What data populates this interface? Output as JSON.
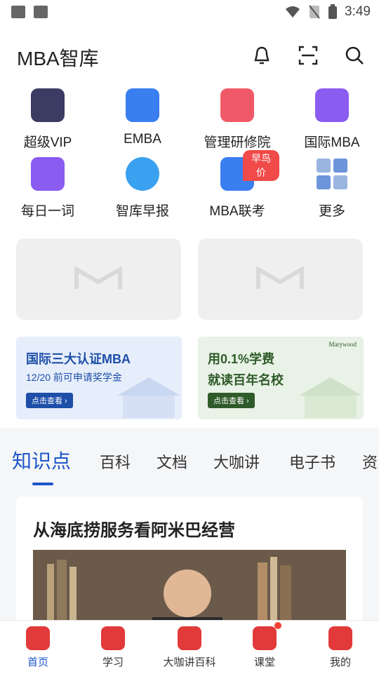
{
  "status": {
    "time": "3:49"
  },
  "header": {
    "title": "MBA智库"
  },
  "quick": {
    "items": [
      {
        "label": "超级VIP",
        "icon": "vip-icon",
        "color": "#3b3b63"
      },
      {
        "label": "EMBA",
        "icon": "document-icon",
        "color": "#3a7ef0"
      },
      {
        "label": "管理研修院",
        "icon": "building-icon",
        "color": "#f05a68"
      },
      {
        "label": "国际MBA",
        "icon": "shield-icon",
        "color": "#8a5cf0"
      },
      {
        "label": "每日一词",
        "icon": "calendar-icon",
        "color": "#8a5cf0"
      },
      {
        "label": "智库早报",
        "icon": "clock-icon",
        "color": "#3aa0f0"
      },
      {
        "label": "MBA联考",
        "icon": "flag-chart-icon",
        "color": "#3a7ef0",
        "badge": "早鸟价"
      },
      {
        "label": "更多",
        "icon": "grid-icon",
        "color": "#7aa6e8"
      }
    ]
  },
  "banners": [
    {
      "line1": "国际三大认证MBA",
      "line2": "12/20 前可申请奖学金",
      "btn": "点击查看 ›",
      "bg": "#e7eefb",
      "fg": "#1d4fa8"
    },
    {
      "line1": "用0.1%学费",
      "line2": "就读百年名校",
      "btn": "点击查看 ›",
      "bg": "#e9f2e6",
      "fg": "#2f5b2a",
      "logo": "Marywood"
    }
  ],
  "tabs": [
    {
      "label": "知识点",
      "active": true
    },
    {
      "label": "百科"
    },
    {
      "label": "文档"
    },
    {
      "label": "大咖讲"
    },
    {
      "label": "电子书"
    },
    {
      "label": "资"
    }
  ],
  "card": {
    "title": "从海底捞服务看阿米巴经营"
  },
  "bottom_nav": [
    {
      "label": "首页",
      "active": true
    },
    {
      "label": "学习"
    },
    {
      "label": "大咖讲百科"
    },
    {
      "label": "课堂",
      "dot": true
    },
    {
      "label": "我的"
    }
  ]
}
